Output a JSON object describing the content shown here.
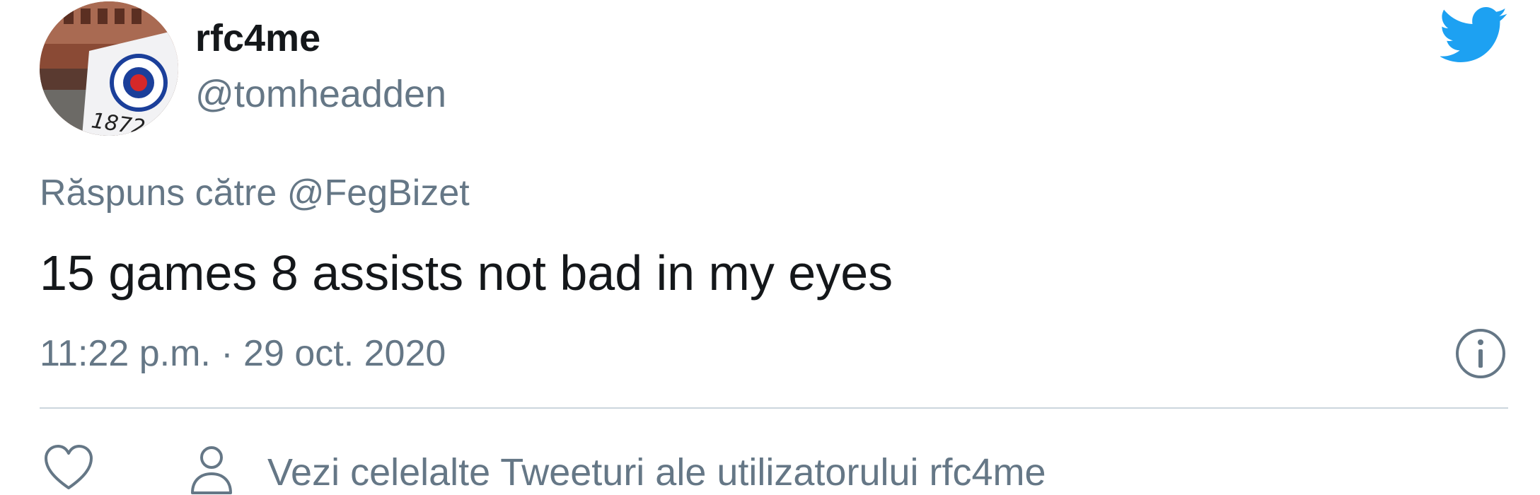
{
  "user": {
    "display_name": "rfc4me",
    "handle": "@tomheadden",
    "avatar_icon": "avatar-photo",
    "avatar_text": "1872"
  },
  "reply": {
    "prefix": "Răspuns către ",
    "handle": "@FegBizet"
  },
  "tweet": {
    "text": "15 games 8 assists not bad in my eyes",
    "timestamp": "11:22 p.m. · 29 oct. 2020"
  },
  "actions": {
    "like_icon": "heart-icon",
    "info_icon": "info-icon",
    "more_tweets_icon": "person-icon",
    "more_tweets_label": "Vezi celelalte Tweeturi ale utilizatorului rfc4me"
  },
  "colors": {
    "twitter_blue": "#1da1f2",
    "secondary_text": "#657786",
    "primary_text": "#14171a",
    "divider": "#ccd6dd"
  },
  "brand": {
    "logo_icon": "twitter-bird-icon"
  }
}
